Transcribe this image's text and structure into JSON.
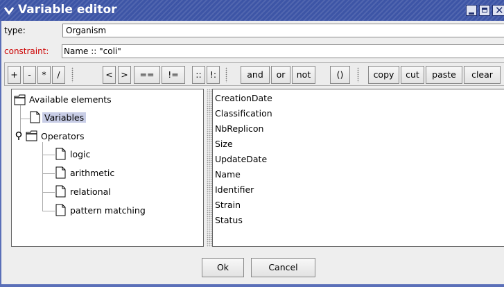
{
  "window": {
    "title": "Variable editor"
  },
  "type_row": {
    "label": "type:",
    "value": "Organism"
  },
  "constraint_row": {
    "label": "constraint:",
    "value": "Name :: \"coli\""
  },
  "toolbar": {
    "buttons": [
      "+",
      "-",
      "*",
      "/",
      "<",
      ">",
      "==",
      "!=",
      "::",
      "!:",
      "and",
      "or",
      "not",
      "()",
      "copy",
      "cut",
      "paste",
      "clear"
    ]
  },
  "tree": {
    "root": "Available elements",
    "variables": "Variables",
    "operators": "Operators",
    "operator_children": [
      "logic",
      "arithmetic",
      "relational",
      "pattern matching"
    ]
  },
  "attributes": [
    "CreationDate",
    "Classification",
    "NbReplicon",
    "Size",
    "UpdateDate",
    "Name",
    "Identifier",
    "Strain",
    "Status"
  ],
  "footer": {
    "ok": "Ok",
    "cancel": "Cancel"
  },
  "colors": {
    "title_bar": "#3d55a6",
    "selection": "#c8cde6",
    "constraint_label": "#cc0000"
  }
}
